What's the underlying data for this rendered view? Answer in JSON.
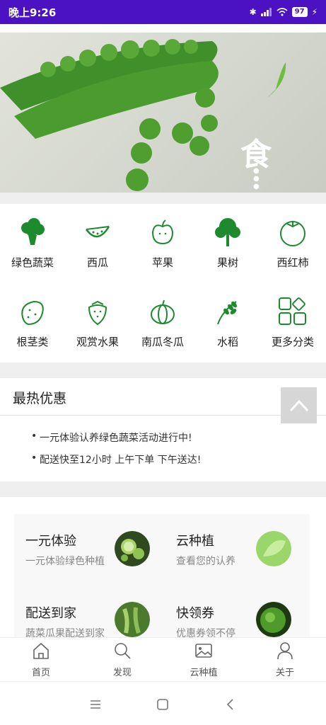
{
  "status_bar": {
    "time": "晚上9:26",
    "battery": "97"
  },
  "banner": {
    "char": "食"
  },
  "categories": [
    {
      "label": "绿色蔬菜",
      "icon": "broccoli-icon"
    },
    {
      "label": "西瓜",
      "icon": "watermelon-icon"
    },
    {
      "label": "苹果",
      "icon": "apple-icon"
    },
    {
      "label": "果树",
      "icon": "fruit-tree-icon"
    },
    {
      "label": "西红柿",
      "icon": "tomato-icon"
    },
    {
      "label": "根茎类",
      "icon": "potato-icon"
    },
    {
      "label": "观赏水果",
      "icon": "strawberry-icon"
    },
    {
      "label": "南瓜冬瓜",
      "icon": "pumpkin-icon"
    },
    {
      "label": "水稻",
      "icon": "rice-icon"
    },
    {
      "label": "更多分类",
      "icon": "more-grid-icon"
    }
  ],
  "hot_deals": {
    "title": "最热优惠",
    "items": [
      "一元体验认养绿色蔬菜活动进行中!",
      "配送快至12小时 上午下单 下午送达!"
    ]
  },
  "cards": [
    {
      "title": "一元体验",
      "subtitle": "一元体验绿色种植"
    },
    {
      "title": "云种植",
      "subtitle": "查看您的认养"
    },
    {
      "title": "配送到家",
      "subtitle": "蔬菜瓜果配送到家"
    },
    {
      "title": "快领券",
      "subtitle": "优惠券领不停"
    }
  ],
  "tab_bar": {
    "items": [
      {
        "label": "首页",
        "icon": "home-icon"
      },
      {
        "label": "发现",
        "icon": "search-icon"
      },
      {
        "label": "云种植",
        "icon": "image-icon"
      },
      {
        "label": "关于",
        "icon": "user-icon"
      }
    ]
  },
  "colors": {
    "status_bar": "#4a12c2",
    "accent_green": "#2a8a2a"
  }
}
